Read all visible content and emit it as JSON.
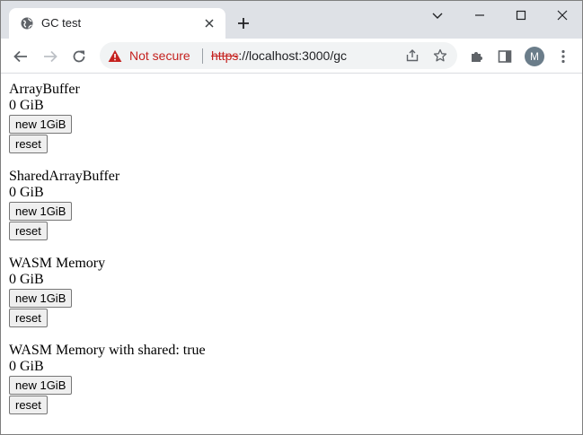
{
  "browser": {
    "tab_title": "GC test",
    "url_scheme": "https",
    "url_rest": "://localhost:3000/gc",
    "security_label": "Not secure",
    "profile_initial": "M",
    "accent_warning": "#c5221f"
  },
  "sections": [
    {
      "label": "ArrayBuffer",
      "value": "0 GiB",
      "new_label": "new 1GiB",
      "reset_label": "reset"
    },
    {
      "label": "SharedArrayBuffer",
      "value": "0 GiB",
      "new_label": "new 1GiB",
      "reset_label": "reset"
    },
    {
      "label": "WASM Memory",
      "value": "0 GiB",
      "new_label": "new 1GiB",
      "reset_label": "reset"
    },
    {
      "label": "WASM Memory with shared: true",
      "value": "0 GiB",
      "new_label": "new 1GiB",
      "reset_label": "reset"
    }
  ]
}
